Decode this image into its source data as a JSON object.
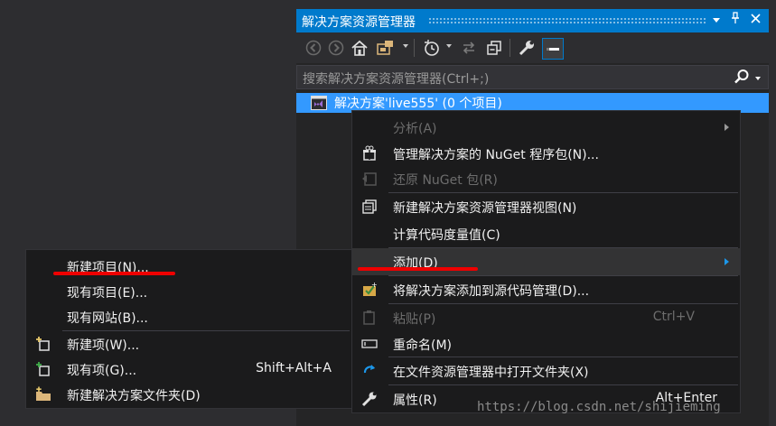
{
  "panel": {
    "title": "解决方案资源管理器",
    "title_buttons": [
      "▾",
      "📌",
      "✕"
    ]
  },
  "search": {
    "placeholder": "搜索解决方案资源管理器(Ctrl+;)"
  },
  "tree": {
    "solution_label": "解决方案'live555' (0 个项目)"
  },
  "context_menu": {
    "items": [
      {
        "label": "分析(A)",
        "icon": "none",
        "disabled": true,
        "submenu": true
      },
      {
        "label": "管理解决方案的 NuGet 程序包(N)...",
        "icon": "nuget-gift-icon"
      },
      {
        "label": "还原 NuGet 包(R)",
        "icon": "restore-package-icon",
        "disabled": true
      },
      {
        "label": "新建解决方案资源管理器视图(N)",
        "icon": "new-view-icon"
      },
      {
        "label": "计算代码度量值(C)",
        "icon": "none"
      },
      {
        "label": "添加(D)",
        "icon": "none",
        "submenu": true,
        "highlighted": true
      },
      {
        "label": "将解决方案添加到源代码管理(D)...",
        "icon": "source-control-add-icon"
      },
      {
        "label": "粘贴(P)",
        "shortcut": "Ctrl+V",
        "icon": "paste-icon",
        "disabled": true
      },
      {
        "label": "重命名(M)",
        "icon": "rename-icon"
      },
      {
        "label": "在文件资源管理器中打开文件夹(X)",
        "icon": "refresh-arrow-icon"
      },
      {
        "label": "属性(R)",
        "shortcut": "Alt+Enter",
        "icon": "wrench-icon"
      }
    ]
  },
  "add_submenu": {
    "items": [
      {
        "label": "新建项目(N)...",
        "icon": "none"
      },
      {
        "label": "现有项目(E)...",
        "icon": "none"
      },
      {
        "label": "现有网站(B)...",
        "icon": "none"
      },
      {
        "label": "新建项(W)...",
        "icon": "new-item-icon"
      },
      {
        "label": "现有项(G)...",
        "shortcut": "Shift+Alt+A",
        "icon": "existing-item-icon"
      },
      {
        "label": "新建解决方案文件夹(D)",
        "icon": "new-folder-icon"
      }
    ]
  },
  "watermark": "https://blog.csdn.net/shijieming",
  "colors": {
    "accent": "#007acc",
    "selection": "#3399ff",
    "annotation": "#ee0000"
  }
}
